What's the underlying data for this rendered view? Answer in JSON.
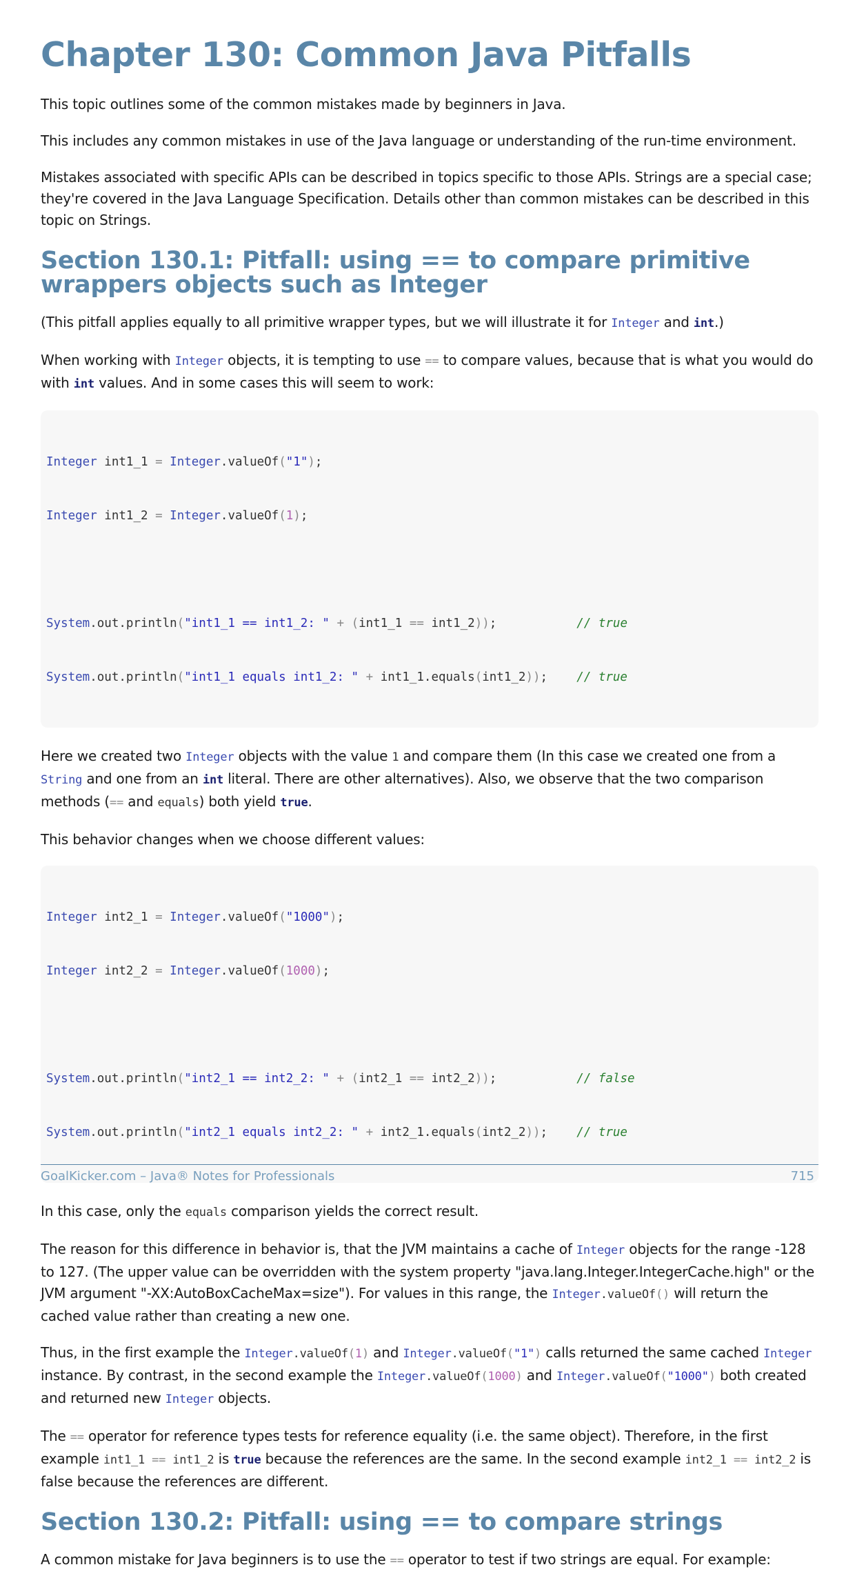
{
  "chapter_title": "Chapter 130: Common Java Pitfalls",
  "intro": {
    "p1": "This topic outlines some of the common mistakes made by beginners in Java.",
    "p2": "This includes any common mistakes in use of the Java language or understanding of the run-time environment.",
    "p3": "Mistakes associated with specific APIs can be described in topics specific to those APIs. Strings are a special case; they're covered in the Java Language Specification. Details other than common mistakes can be described in this topic on Strings."
  },
  "section1": {
    "title": "Section 130.1: Pitfall: using == to compare primitive wrappers objects such as Integer",
    "p1_a": "(This pitfall applies equally to all primitive wrapper types, but we will illustrate it for ",
    "p1_b": " and ",
    "p1_c": ".)",
    "p2_a": "When working with ",
    "p2_b": " objects, it is tempting to use ",
    "p2_c": " to compare values, because that is what you would do with ",
    "p2_d": " values. And in some cases this will seem to work:",
    "p3_a": "Here we created two ",
    "p3_b": " objects with the value ",
    "p3_c": " and compare them (In this case we created one from a ",
    "p3_d": " and one from an ",
    "p3_e": " literal. There are other alternatives). Also, we observe that the two comparison methods (",
    "p3_f": " and ",
    "p3_g": ") both yield ",
    "p3_h": ".",
    "p4": "This behavior changes when we choose different values:",
    "p5_a": "In this case, only the ",
    "p5_b": " comparison yields the correct result.",
    "p6_a": "The reason for this difference in behavior is, that the JVM maintains a cache of ",
    "p6_b": " objects for the range -128 to 127. (The upper value can be overridden with the system property \"java.lang.Integer.IntegerCache.high\" or the JVM argument \"-XX:AutoBoxCacheMax=size\"). For values in this range, the ",
    "p6_c": " will return the cached value rather than creating a new one.",
    "p7_a": "Thus, in the first example the ",
    "p7_b": " and ",
    "p7_c": " calls returned the same cached ",
    "p7_d": " instance. By contrast, in the second example the ",
    "p7_e": " and ",
    "p7_f": " both created and returned new ",
    "p7_g": " objects.",
    "p8_a": "The ",
    "p8_b": " operator for reference types tests for reference equality (i.e. the same object). Therefore, in the first example ",
    "p8_c": " is ",
    "p8_d": " because the references are the same. In the second example ",
    "p8_e": " is false because the references are different."
  },
  "code_tokens": {
    "Integer": "Integer",
    "int": "int",
    "eq": "==",
    "one": "1",
    "String": "String",
    "equals": "equals",
    "true": "true",
    "Integer_valueOf": "Integer",
    "valueOf": ".valueOf",
    "paren_empty": "()",
    "paren_open": "(",
    "paren_close": ")",
    "str_1": "\"1\"",
    "num_1000": "1000",
    "str_1000": "\"1000\"",
    "int1_1": "int1_1",
    "int1_2": "int1_2",
    "int2_1": "int2_1",
    "int2_2": "int2_2"
  },
  "code_block_1": [
    "Integer int1_1 = Integer.valueOf(\"1\");",
    "Integer int1_2 = Integer.valueOf(1);",
    "",
    "System.out.println(\"int1_1 == int1_2: \" + (int1_1 == int1_2));           // true",
    "System.out.println(\"int1_1 equals int1_2: \" + int1_1.equals(int1_2));    // true"
  ],
  "code_block_2": [
    "Integer int2_1 = Integer.valueOf(\"1000\");",
    "Integer int2_2 = Integer.valueOf(1000);",
    "",
    "System.out.println(\"int2_1 == int2_2: \" + (int2_1 == int2_2));           // false",
    "System.out.println(\"int2_1 equals int2_2: \" + int2_1.equals(int2_2));    // true"
  ],
  "section2": {
    "title": "Section 130.2: Pitfall: using == to compare strings",
    "p1_a": "A common mistake for Java beginners is to use the ",
    "p1_b": " operator to test if two strings are equal. For example:"
  },
  "footer": {
    "left": "GoalKicker.com – Java® Notes for Professionals",
    "page_number": "715"
  }
}
